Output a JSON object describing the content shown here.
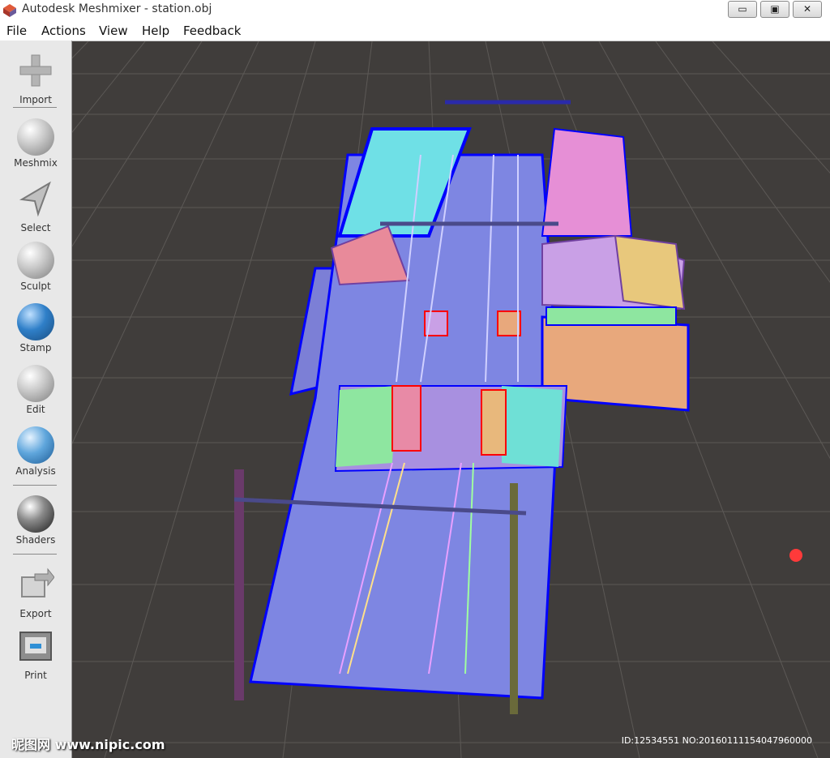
{
  "window": {
    "title": "Autodesk Meshmixer - station.obj",
    "minimize": "▭",
    "restore": "▣",
    "close": "✕"
  },
  "menu": [
    "File",
    "Actions",
    "View",
    "Help",
    "Feedback"
  ],
  "tools": [
    "Import",
    "Meshmix",
    "Select",
    "Sculpt",
    "Stamp",
    "Edit",
    "Analysis",
    "Shaders",
    "Export",
    "Print"
  ],
  "icons": [
    "plus-icon",
    "meshmix-face-icon",
    "cursor-arrow-icon",
    "brush-icon",
    "stamp-icon",
    "edit-mesh-icon",
    "analysis-mesh-icon",
    "shader-sphere-icon",
    "export-icon",
    "printer-icon"
  ],
  "colors": {
    "mesh_outline": "#0000ff",
    "viewport_bg": "#403d3b",
    "grid": "#5c5956",
    "track_base": "#7e86e2"
  },
  "watermark": {
    "text": "昵图网 www.nipic.com",
    "id": "ID:12534551 NO:20160111154047960000"
  }
}
